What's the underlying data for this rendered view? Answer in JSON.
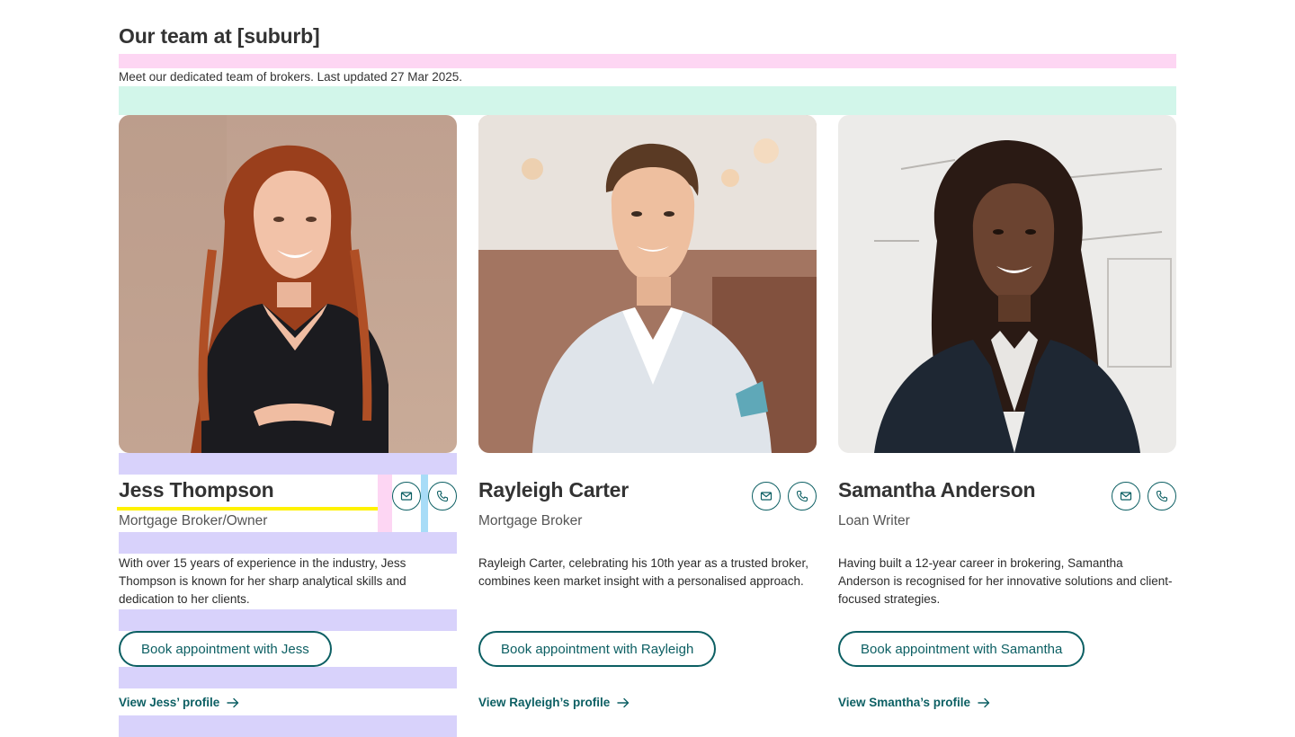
{
  "section": {
    "title": "Our team at [suburb]",
    "subtitle": "Meet our dedicated team of brokers. Last updated 27 Mar 2025."
  },
  "colors": {
    "accent": "#0c5f63",
    "heading": "#333333",
    "spacer_pink": "#fdd6f3",
    "spacer_mint": "#d2f6ea",
    "spacer_lavender": "#d8d2fb",
    "spacer_blue": "#a8dcf7",
    "underline_yellow": "#fff200"
  },
  "icons": {
    "mail": "envelope-icon",
    "phone": "phone-icon",
    "arrow": "arrow-right-icon"
  },
  "brokers": [
    {
      "name": "Jess Thompson",
      "role": "Mortgage Broker/Owner",
      "bio": "With over 15 years of experience in the industry, Jess Thompson is known for her sharp analytical skills and dedication to her clients.",
      "book_label": "Book appointment with Jess",
      "profile_label": "View Jess’ profile"
    },
    {
      "name": "Rayleigh Carter",
      "role": "Mortgage Broker",
      "bio": "Rayleigh Carter, celebrating his 10th year as a trusted broker, combines keen market insight with a personalised approach.",
      "book_label": "Book appointment with Rayleigh",
      "profile_label": "View Rayleigh’s profile"
    },
    {
      "name": "Samantha Anderson",
      "role": "Loan Writer",
      "bio": "Having built a 12-year career in brokering, Samantha Anderson is recognised for her innovative solutions and client-focused strategies.",
      "book_label": "Book appointment with Samantha",
      "profile_label": "View Smantha’s profile"
    }
  ]
}
